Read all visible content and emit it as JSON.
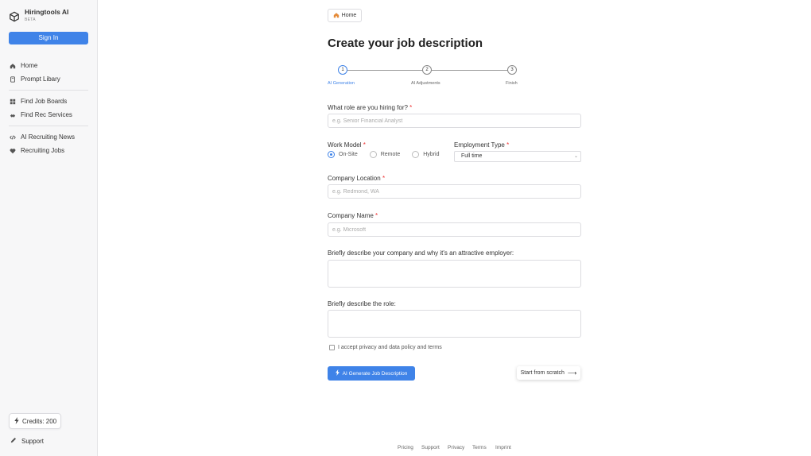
{
  "sidebar": {
    "brand_name": "Hiringtools AI",
    "brand_tag": "BETA",
    "sign_in": "Sign In",
    "group1": [
      {
        "label": "Home",
        "icon": "home-icon"
      },
      {
        "label": "Prompt Libary",
        "icon": "book-icon"
      }
    ],
    "group2": [
      {
        "label": "Find Job Boards",
        "icon": "grid-icon"
      },
      {
        "label": "Find Rec Services",
        "icon": "handshake-icon"
      }
    ],
    "group3": [
      {
        "label": "AI Recruiting News",
        "icon": "code-icon"
      },
      {
        "label": "Recruiting Jobs",
        "icon": "heart-icon"
      }
    ],
    "credits": "Credits: 200",
    "support": "Support"
  },
  "main": {
    "home_button": "Home",
    "title": "Create your job description",
    "steps": [
      {
        "number": "1",
        "label": "AI Generation"
      },
      {
        "number": "2",
        "label": "AI Adjustments"
      },
      {
        "number": "3",
        "label": "Finish"
      }
    ],
    "role_label": "What role are you hiring for?",
    "role_placeholder": "e.g. Senior Financial Analyst",
    "work_model_label": "Work Model",
    "work_model_options": [
      "On-Site",
      "Remote",
      "Hybrid"
    ],
    "work_model_selected": "On-Site",
    "employment_type_label": "Employment Type",
    "employment_type_value": "Full time",
    "location_label": "Company Location",
    "location_placeholder": "e.g. Redmond, WA",
    "company_label": "Company Name",
    "company_placeholder": "e.g. Microsoft",
    "company_desc_label": "Briefly describe your company and why it's an attractive employer:",
    "role_desc_label": "Briefly describe the role:",
    "accept_label": "I accept privacy and data policy and terms",
    "generate_button": "AI Generate Job Description",
    "scratch_button": "Start from scratch",
    "required_mark": "*"
  },
  "footer": {
    "links": [
      "Pricing",
      "Support",
      "Privacy",
      "Terms",
      "Imprint"
    ]
  },
  "colors": {
    "accent": "#3f83e8",
    "required": "#ee3333"
  }
}
